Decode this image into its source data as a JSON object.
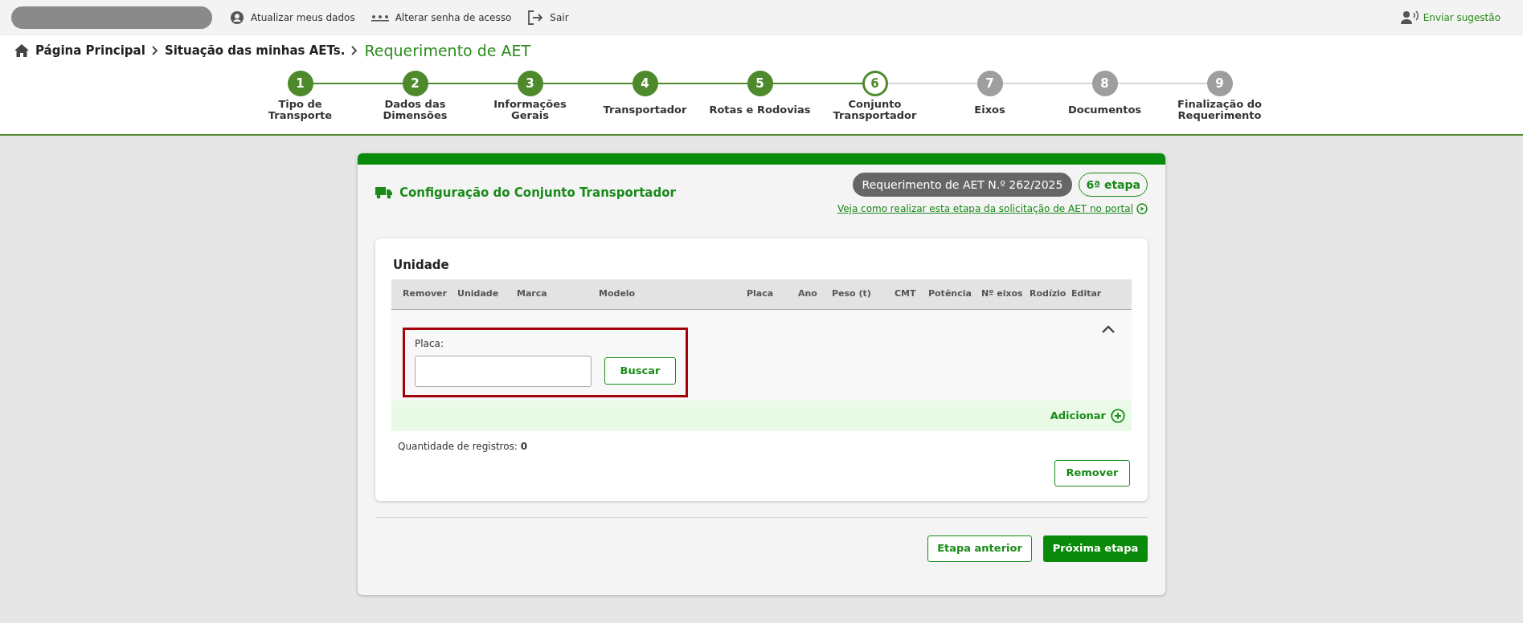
{
  "top_bar": {
    "links": [
      {
        "label": "Atualizar meus dados",
        "kind": "user"
      },
      {
        "label": "Alterar senha de acesso",
        "kind": "password"
      },
      {
        "label": "Sair",
        "kind": "exit"
      }
    ],
    "suggestion": "Enviar sugestão"
  },
  "breadcrumb": [
    "Página Principal",
    "Situação das minhas AETs.",
    "Requerimento de AET"
  ],
  "steps": [
    {
      "number": "1",
      "label": "Tipo de Transporte",
      "done": true,
      "selected": false
    },
    {
      "number": "2",
      "label": "Dados das Dimensões",
      "done": true,
      "selected": false
    },
    {
      "number": "3",
      "label": "Informações Gerais",
      "done": true,
      "selected": false
    },
    {
      "number": "4",
      "label": "Transportador",
      "done": true,
      "selected": false
    },
    {
      "number": "5",
      "label": "Rotas e Rodovias",
      "done": true,
      "selected": false
    },
    {
      "number": "6",
      "label": "Conjunto Transportador",
      "done": false,
      "selected": true
    },
    {
      "number": "7",
      "label": "Eixos",
      "done": false,
      "selected": false
    },
    {
      "number": "8",
      "label": "Documentos",
      "done": false,
      "selected": false
    },
    {
      "number": "9",
      "label": "Finalização do Requerimento",
      "done": false,
      "selected": false
    }
  ],
  "card": {
    "title": "Configuração do Conjunto Transportador",
    "request_badge": "Requerimento de AET N.º 262/2025",
    "stage_badge": "6ª etapa",
    "help_link": "Veja como realizar esta etapa da solicitação de AET no portal"
  },
  "unit_panel": {
    "title": "Unidade",
    "columns": [
      "Remover",
      "Unidade",
      "Marca",
      "Modelo",
      "Placa",
      "Ano",
      "Peso (t)",
      "CMT",
      "Potência",
      "Nº eixos",
      "Rodízio",
      "Editar"
    ],
    "expanded": true,
    "search": {
      "label": "Placa:",
      "button": "Buscar"
    },
    "add_label": "Adicionar",
    "count_label": "Quantidade de registros: ",
    "count": "0",
    "remove_button": "Remover"
  },
  "footer": {
    "back": "Etapa anterior",
    "next": "Próxima etapa"
  }
}
